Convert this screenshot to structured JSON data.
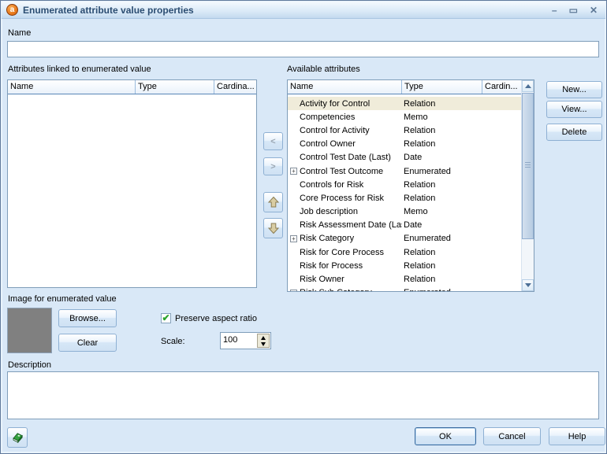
{
  "window": {
    "title": "Enumerated attribute value properties",
    "icon_glyph": "a",
    "controls": {
      "minimize": "–",
      "maximize": "▭",
      "close": "✕"
    }
  },
  "name_field": {
    "label": "Name",
    "value": ""
  },
  "linked_attributes": {
    "label": "Attributes linked to enumerated value",
    "columns": [
      "Name",
      "Type",
      "Cardina..."
    ],
    "rows": []
  },
  "available_attributes": {
    "label": "Available attributes",
    "columns": [
      "Name",
      "Type",
      "Cardin..."
    ],
    "expander_glyph": "+",
    "rows": [
      {
        "name": "Activity for Control",
        "type": "Relation",
        "expandable": false,
        "selected": true
      },
      {
        "name": "Competencies",
        "type": "Memo",
        "expandable": false,
        "selected": false
      },
      {
        "name": "Control for Activity",
        "type": "Relation",
        "expandable": false,
        "selected": false
      },
      {
        "name": "Control Owner",
        "type": "Relation",
        "expandable": false,
        "selected": false
      },
      {
        "name": "Control Test Date (Last)",
        "type": "Date",
        "expandable": false,
        "selected": false
      },
      {
        "name": "Control Test Outcome",
        "type": "Enumerated",
        "expandable": true,
        "selected": false
      },
      {
        "name": "Controls for Risk",
        "type": "Relation",
        "expandable": false,
        "selected": false
      },
      {
        "name": "Core Process for Risk",
        "type": "Relation",
        "expandable": false,
        "selected": false
      },
      {
        "name": "Job description",
        "type": "Memo",
        "expandable": false,
        "selected": false
      },
      {
        "name": "Risk Assessment Date (Last)",
        "type": "Date",
        "expandable": false,
        "selected": false
      },
      {
        "name": "Risk Category",
        "type": "Enumerated",
        "expandable": true,
        "selected": false
      },
      {
        "name": "Risk for Core Process",
        "type": "Relation",
        "expandable": false,
        "selected": false
      },
      {
        "name": "Risk for Process",
        "type": "Relation",
        "expandable": false,
        "selected": false
      },
      {
        "name": "Risk Owner",
        "type": "Relation",
        "expandable": false,
        "selected": false
      },
      {
        "name": "Risk Sub Category",
        "type": "Enumerated",
        "expandable": true,
        "selected": false
      }
    ]
  },
  "transfer_buttons": {
    "move_left": "<",
    "move_right": ">"
  },
  "action_buttons": {
    "new": "New...",
    "view": "View...",
    "delete": "Delete"
  },
  "image_section": {
    "label": "Image for enumerated value",
    "browse": "Browse...",
    "clear": "Clear",
    "preserve_aspect_ratio": {
      "label": "Preserve aspect ratio",
      "checked": true,
      "check_glyph": "✔"
    },
    "scale": {
      "label": "Scale:",
      "value": "100"
    }
  },
  "description": {
    "label": "Description",
    "value": ""
  },
  "footer": {
    "ok": "OK",
    "cancel": "Cancel",
    "help": "Help"
  },
  "colors": {
    "dialog_bg": "#d9e8f7",
    "titlebar_text": "#2b4d72",
    "field_border": "#7f9db9",
    "selected_row_bg": "#f0ecda",
    "button_border": "#8eb0d3",
    "check_green": "#2ba32b",
    "logo_orange": "#e87a1e",
    "preview_gray": "#808080"
  }
}
